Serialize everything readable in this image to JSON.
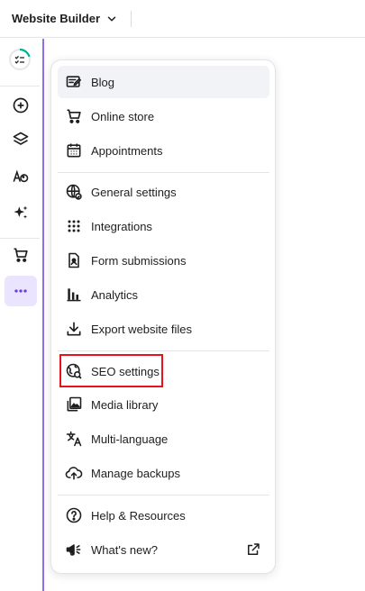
{
  "topbar": {
    "title": "Website Builder",
    "chevron_icon": "chevron-down-icon"
  },
  "rail": {
    "items": [
      {
        "icon": "checklist-progress-icon"
      },
      {
        "icon": "add-circle-icon"
      },
      {
        "icon": "layers-icon"
      },
      {
        "icon": "design-palette-icon"
      },
      {
        "icon": "ai-sparkle-icon"
      },
      {
        "icon": "cart-icon"
      },
      {
        "icon": "more-dots-icon",
        "active": true
      }
    ]
  },
  "menu": {
    "groups": [
      [
        {
          "label": "Blog",
          "icon": "blog-edit-icon",
          "hover": true
        },
        {
          "label": "Online store",
          "icon": "cart-icon"
        },
        {
          "label": "Appointments",
          "icon": "calendar-icon"
        }
      ],
      [
        {
          "label": "General settings",
          "icon": "globe-settings-icon"
        },
        {
          "label": "Integrations",
          "icon": "grid-dots-icon"
        },
        {
          "label": "Form submissions",
          "icon": "form-document-icon"
        },
        {
          "label": "Analytics",
          "icon": "bar-chart-icon"
        },
        {
          "label": "Export website files",
          "icon": "download-icon"
        }
      ],
      [
        {
          "label": "SEO settings",
          "icon": "seo-search-globe-icon",
          "highlighted": true
        },
        {
          "label": "Media library",
          "icon": "image-library-icon"
        },
        {
          "label": "Multi-language",
          "icon": "translate-icon"
        },
        {
          "label": "Manage backups",
          "icon": "cloud-upload-icon"
        }
      ],
      [
        {
          "label": "Help & Resources",
          "icon": "help-circle-icon"
        },
        {
          "label": "What's new?",
          "icon": "megaphone-icon",
          "trailing_icon": "external-link-icon"
        }
      ]
    ]
  },
  "colors": {
    "accent": "#673de6",
    "active_bg": "#ebe4ff",
    "highlight_border": "#e5141c",
    "text": "#1d1e20"
  }
}
